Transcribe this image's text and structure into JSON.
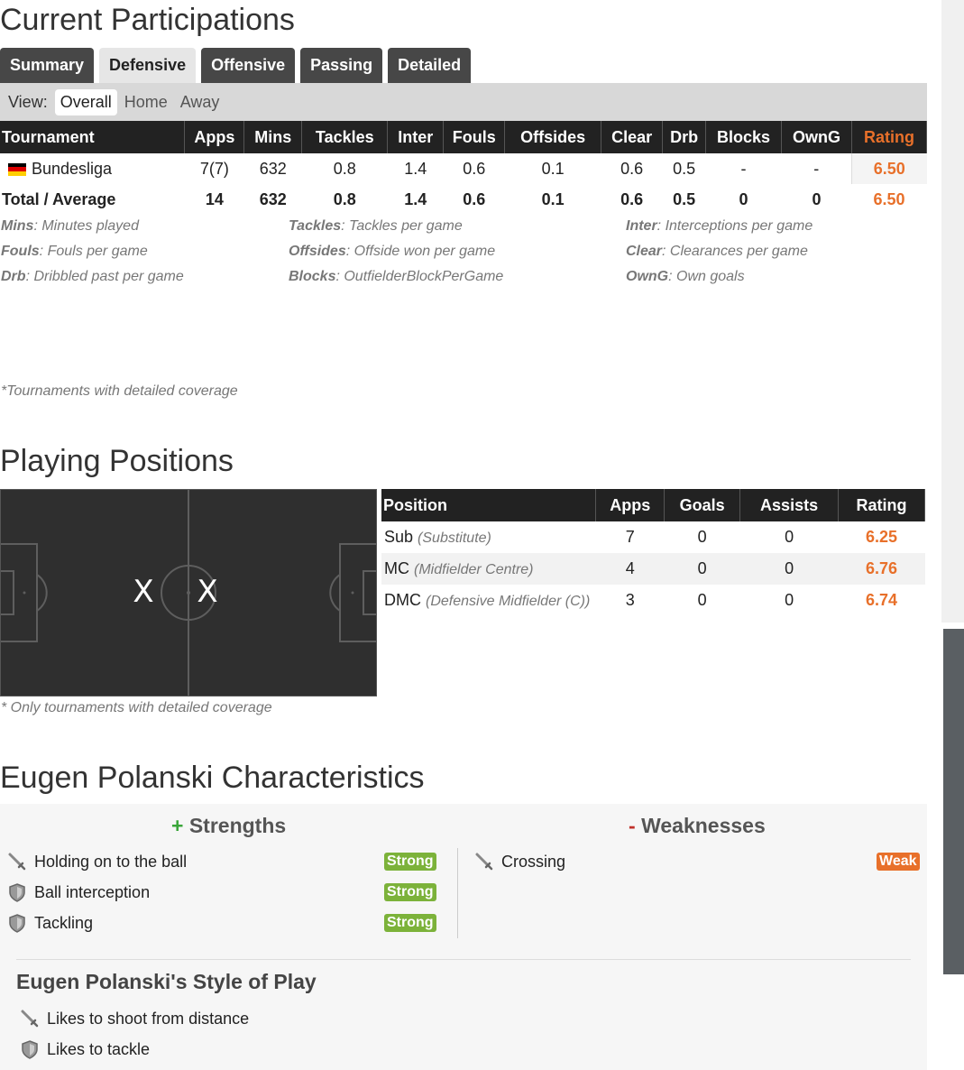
{
  "participations": {
    "title": "Current Participations",
    "tabs": [
      "Summary",
      "Defensive",
      "Offensive",
      "Passing",
      "Detailed"
    ],
    "active_tab": "Defensive",
    "view_label": "View:",
    "view_options": [
      "Overall",
      "Home",
      "Away"
    ],
    "headers": [
      "Tournament",
      "Apps",
      "Mins",
      "Tackles",
      "Inter",
      "Fouls",
      "Offsides",
      "Clear",
      "Drb",
      "Blocks",
      "OwnG",
      "Rating"
    ],
    "rows": [
      {
        "tournament": "Bundesliga",
        "apps": "7(7)",
        "mins": "632",
        "tackles": "0.8",
        "inter": "1.4",
        "fouls": "0.6",
        "offsides": "0.1",
        "clear": "0.6",
        "drb": "0.5",
        "blocks": "-",
        "owng": "-",
        "rating": "6.50"
      }
    ],
    "total": {
      "label": "Total / Average",
      "apps": "14",
      "mins": "632",
      "tackles": "0.8",
      "inter": "1.4",
      "fouls": "0.6",
      "offsides": "0.1",
      "clear": "0.6",
      "drb": "0.5",
      "blocks": "0",
      "owng": "0",
      "rating": "6.50"
    },
    "legend": [
      {
        "abbr": "Mins",
        "desc": ": Minutes played"
      },
      {
        "abbr": "Tackles",
        "desc": ": Tackles per game"
      },
      {
        "abbr": "Inter",
        "desc": ": Interceptions per game"
      },
      {
        "abbr": "Fouls",
        "desc": ": Fouls per game"
      },
      {
        "abbr": "Offsides",
        "desc": ": Offside won per game"
      },
      {
        "abbr": "Clear",
        "desc": ": Clearances per game"
      },
      {
        "abbr": "Drb",
        "desc": ": Dribbled past per game"
      },
      {
        "abbr": "Blocks",
        "desc": ": OutfielderBlockPerGame"
      },
      {
        "abbr": "OwnG",
        "desc": ": Own goals"
      }
    ],
    "note": "*Tournaments with detailed coverage"
  },
  "positions": {
    "title": "Playing Positions",
    "headers": [
      "Position",
      "Apps",
      "Goals",
      "Assists",
      "Rating"
    ],
    "rows": [
      {
        "pos": "Sub",
        "long": "(Substitute)",
        "apps": "7",
        "goals": "0",
        "assists": "0",
        "rating": "6.25"
      },
      {
        "pos": "MC",
        "long": "(Midfielder Centre)",
        "apps": "4",
        "goals": "0",
        "assists": "0",
        "rating": "6.76"
      },
      {
        "pos": "DMC",
        "long": "(Defensive Midfielder (C))",
        "apps": "3",
        "goals": "0",
        "assists": "0",
        "rating": "6.74"
      }
    ],
    "note": "* Only tournaments with detailed coverage",
    "marker": "X"
  },
  "characteristics": {
    "title": "Eugen Polanski Characteristics",
    "strengths_sign": "+",
    "strengths_label": "Strengths",
    "weaknesses_sign": "-",
    "weaknesses_label": "Weaknesses",
    "strengths": [
      {
        "label": "Holding on to the ball",
        "level": "Strong",
        "icon": "sword-icon"
      },
      {
        "label": "Ball interception",
        "level": "Strong",
        "icon": "shield-icon"
      },
      {
        "label": "Tackling",
        "level": "Strong",
        "icon": "shield-icon"
      }
    ],
    "weaknesses": [
      {
        "label": "Crossing",
        "level": "Weak",
        "icon": "sword-icon"
      }
    ],
    "style_title": "Eugen Polanski's Style of Play",
    "style": [
      {
        "label": "Likes to shoot from distance",
        "icon": "sword-icon"
      },
      {
        "label": "Likes to tackle",
        "icon": "shield-icon"
      }
    ]
  },
  "colors": {
    "accent": "#e8702a",
    "header": "#222222",
    "strong": "#7cb23a",
    "weak": "#e8702a"
  }
}
